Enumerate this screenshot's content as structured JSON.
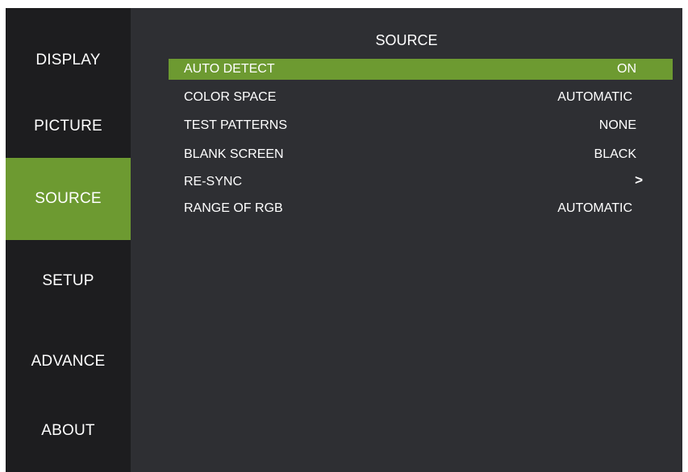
{
  "sidebar": {
    "items": [
      {
        "label": "DISPLAY"
      },
      {
        "label": "PICTURE"
      },
      {
        "label": "SOURCE"
      },
      {
        "label": "SETUP"
      },
      {
        "label": "ADVANCE"
      },
      {
        "label": "ABOUT"
      }
    ],
    "active": "SOURCE"
  },
  "panel": {
    "title": "SOURCE",
    "rows": [
      {
        "label": "AUTO DETECT",
        "value": "ON"
      },
      {
        "label": "COLOR SPACE",
        "value": "AUTOMATIC"
      },
      {
        "label": "TEST PATTERNS",
        "value": "NONE"
      },
      {
        "label": "BLANK SCREEN",
        "value": "BLACK"
      },
      {
        "label": "RE-SYNC",
        "value": ">"
      },
      {
        "label": "RANGE OF RGB",
        "value": "AUTOMATIC"
      }
    ],
    "selected": "AUTO DETECT"
  },
  "colors": {
    "accent": "#6d9a31",
    "sidebar_bg": "#1d1d1f",
    "panel_bg": "#2e2f33",
    "text": "#ffffff"
  }
}
